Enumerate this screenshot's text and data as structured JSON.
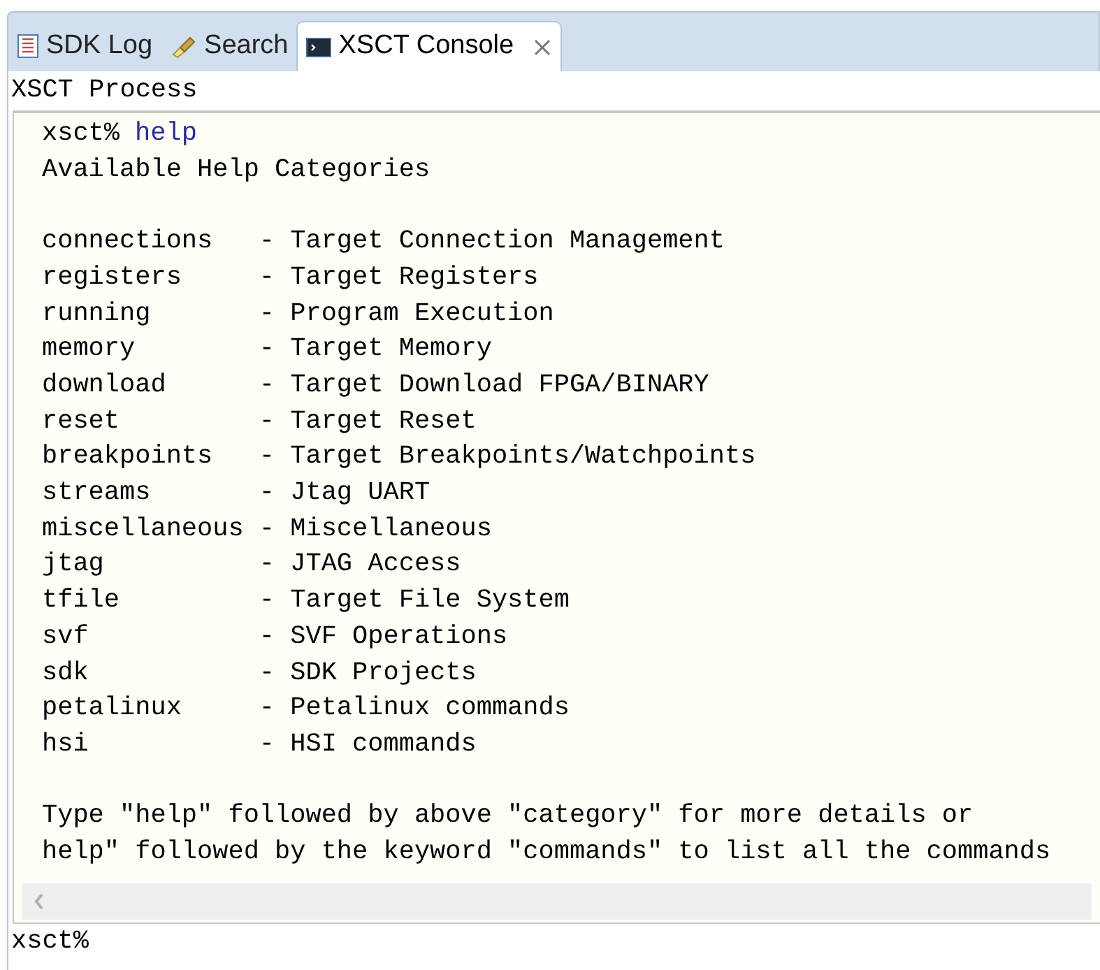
{
  "tabs": [
    {
      "label": "SDK Log",
      "kind": "log",
      "selected": false,
      "closable": false
    },
    {
      "label": "Search",
      "kind": "search",
      "selected": false,
      "closable": false
    },
    {
      "label": "XSCT Console",
      "kind": "console",
      "selected": true,
      "closable": true
    }
  ],
  "process_title": "XSCT Process",
  "console": {
    "prompt": "xsct%",
    "command": "help",
    "heading": "Available Help Categories",
    "categories": [
      {
        "name": "connections",
        "description": "- Target Connection Management"
      },
      {
        "name": "registers",
        "description": "- Target Registers"
      },
      {
        "name": "running",
        "description": "- Program Execution"
      },
      {
        "name": "memory",
        "description": "- Target Memory"
      },
      {
        "name": "download",
        "description": "- Target Download FPGA/BINARY"
      },
      {
        "name": "reset",
        "description": "- Target Reset"
      },
      {
        "name": "breakpoints",
        "description": "- Target Breakpoints/Watchpoints"
      },
      {
        "name": "streams",
        "description": "- Jtag UART"
      },
      {
        "name": "miscellaneous",
        "description": "- Miscellaneous"
      },
      {
        "name": "jtag",
        "description": "- JTAG Access"
      },
      {
        "name": "tfile",
        "description": "- Target File System"
      },
      {
        "name": "svf",
        "description": "- SVF Operations"
      },
      {
        "name": "sdk",
        "description": "- SDK Projects"
      },
      {
        "name": "petalinux",
        "description": "- Petalinux commands"
      },
      {
        "name": "hsi",
        "description": "- HSI commands"
      }
    ],
    "footer": [
      "Type \"help\" followed by above \"category\" for more details or",
      "help\" followed by the keyword \"commands\" to list all the commands"
    ]
  },
  "input_prompt": "xsct%"
}
